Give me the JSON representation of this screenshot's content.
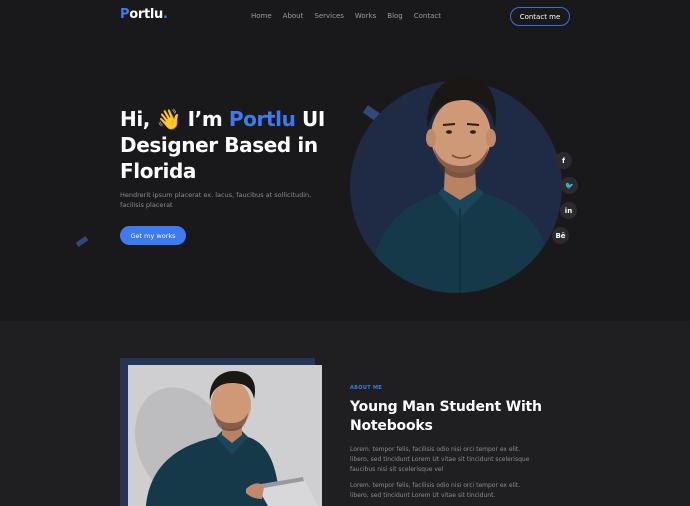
{
  "nav": {
    "logo_initial": "P",
    "logo_rest": "ortlu",
    "logo_dot": ".",
    "items": [
      "Home",
      "About",
      "Services",
      "Works",
      "Blog",
      "Contact"
    ],
    "contact_button": "Contact me"
  },
  "hero": {
    "title_prefix": "Hi, ",
    "wave_emoji": "👋",
    "title_im": " I’m ",
    "title_accent": "Portlu",
    "title_rest": " UI Designer Based in Florida",
    "description": "Hendrerit ipsum placerat ex. lacus, faucibus at sollicitudin, facilisis placerat",
    "cta_label": "Get my works",
    "socials": [
      {
        "icon": "facebook-icon",
        "glyph": "f"
      },
      {
        "icon": "twitter-icon",
        "glyph": "🐦"
      },
      {
        "icon": "linkedin-icon",
        "glyph": "in"
      },
      {
        "icon": "behance-icon",
        "glyph": "Bē"
      }
    ]
  },
  "about": {
    "tag": "ABOUT ME",
    "title": "Young Man Student With Notebooks",
    "paragraph1": "Lorem. tempor felis, facilisis odio nisi orci tempor ex elit. libero, sed tincidunt Lorem Ut vitae sit tincidunt scelerisque faucibus nisi sit scelerisque vel",
    "paragraph2": "Lorem. tempor felis, facilisis odio nisi orci tempor ex elit. libero, sed tincidunt Lorem Ut vitae sit tincidunt."
  },
  "colors": {
    "background": "#19191b",
    "accent": "#3f7bf0",
    "circle": "#1f2a45",
    "section_bg": "#1f1f22"
  }
}
